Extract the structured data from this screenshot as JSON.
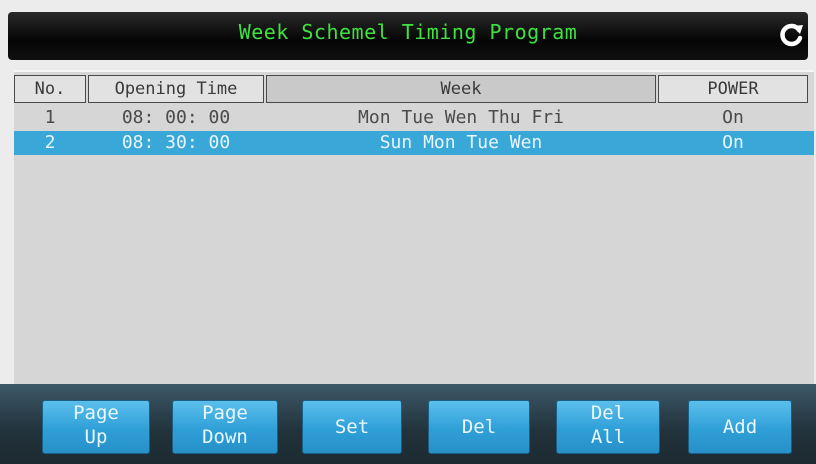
{
  "title": "Week Schemel Timing Program",
  "table": {
    "headers": {
      "no": "No.",
      "opening_time": "Opening Time",
      "week": "Week",
      "power": "POWER"
    },
    "rows": [
      {
        "no": "1",
        "time": "08: 00: 00",
        "week": "Mon Tue Wen Thu Fri",
        "power": "On",
        "selected": false
      },
      {
        "no": "2",
        "time": "08: 30: 00",
        "week": "Sun Mon Tue Wen",
        "power": "On",
        "selected": true
      }
    ]
  },
  "buttons": {
    "page_up": [
      "Page",
      "Up"
    ],
    "page_down": [
      "Page",
      "Down"
    ],
    "set": "Set",
    "del": "Del",
    "del_all": [
      "Del",
      "All"
    ],
    "add": "Add"
  },
  "colors": {
    "title_text": "#3fe23f",
    "selected_row": "#3aa7d9",
    "button": "#2f9fd8"
  },
  "icons": {
    "refresh": "refresh-icon"
  }
}
